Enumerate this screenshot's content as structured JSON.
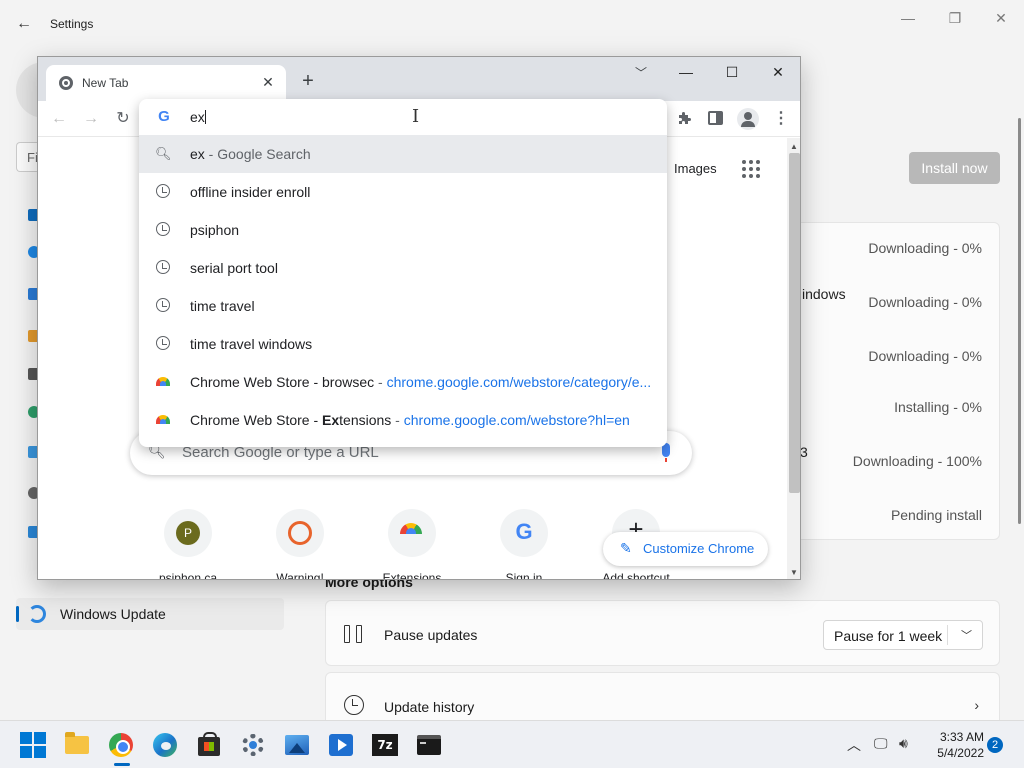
{
  "settings": {
    "title": "Settings",
    "search_fragment": "Fi",
    "nav_selected": "Windows Update",
    "install_button": "Install now",
    "update_fragment": "indows",
    "update_fragment_2": "3",
    "update_statuses": [
      "Downloading - 0%",
      "Downloading - 0%",
      "Downloading - 0%",
      "Installing - 0%",
      "Downloading - 100%",
      "Pending install"
    ],
    "more_options": "More options",
    "pause_updates": "Pause updates",
    "pause_select_value": "Pause for 1 week",
    "update_history": "Update history"
  },
  "chrome": {
    "tab_title": "New Tab",
    "omnibox_text": "ex",
    "suggestions": [
      {
        "icon": "search-icon",
        "main": "ex",
        "suffix": " - Google Search"
      },
      {
        "icon": "history-icon",
        "main": "offline insider enroll"
      },
      {
        "icon": "history-icon",
        "main": "psiphon"
      },
      {
        "icon": "history-icon",
        "main": "serial port tool"
      },
      {
        "icon": "history-icon",
        "main": "time travel"
      },
      {
        "icon": "history-icon",
        "main": "time travel windows"
      },
      {
        "icon": "chrome-web-store-icon",
        "main": "Chrome Web Store - browsec",
        "sep": " - ",
        "url": "chrome.google.com/webstore/category/e..."
      },
      {
        "icon": "chrome-web-store-icon",
        "main_prefix": "Chrome Web Store - ",
        "main_bold": "Ex",
        "main_rest": "tensions",
        "sep": " - ",
        "url": "chrome.google.com/webstore?hl=en"
      }
    ],
    "images_link": "Images",
    "search_placeholder": "Search Google or type a URL",
    "shortcuts": [
      {
        "label": "psiphon.ca",
        "glyph": "P"
      },
      {
        "label": "Warning!"
      },
      {
        "label": "Extensions"
      },
      {
        "label": "Sign in",
        "glyph": "G"
      },
      {
        "label": "Add shortcut",
        "glyph": "+"
      }
    ],
    "customize_label": "Customize Chrome"
  },
  "taskbar": {
    "time": "3:33 AM",
    "date": "5/4/2022",
    "notification_count": "2"
  },
  "colors": {
    "accent": "#0067c0",
    "chrome_link": "#1a73e8"
  }
}
